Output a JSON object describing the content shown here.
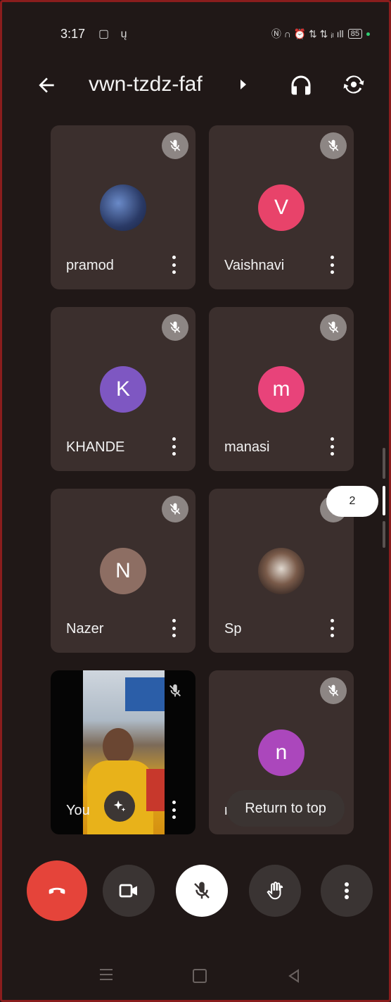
{
  "status_bar": {
    "time": "3:17",
    "left_icons": "▢ ų",
    "right_icons": "Ⓝ ∩ ⏰ ⇅ ⇅ ᵢₗ ıll",
    "battery": "85"
  },
  "header": {
    "meeting_code": "vwn-tzdz-faf"
  },
  "participants": [
    {
      "name": "pramod",
      "initial": "",
      "avatar_color": ""
    },
    {
      "name": "Vaishnavi",
      "initial": "V",
      "avatar_color": "#e8436a"
    },
    {
      "name": "KHANDE",
      "initial": "K",
      "avatar_color": "#7e57c2"
    },
    {
      "name": "manasi",
      "initial": "m",
      "avatar_color": "#e8437a"
    },
    {
      "name": "Nazer",
      "initial": "N",
      "avatar_color": "#8d6e63"
    },
    {
      "name": "Sp",
      "initial": "",
      "avatar_color": ""
    },
    {
      "name": "You",
      "initial": "",
      "avatar_color": ""
    },
    {
      "name": "n",
      "initial": "n",
      "avatar_color": "#ab47bc"
    }
  ],
  "page_indicator": "2",
  "return_to_top": "Return to top",
  "icons": {
    "back": "arrow-left-icon",
    "audio": "headphones-icon",
    "switch_camera": "switch-camera-icon",
    "muted": "mic-off-icon",
    "end_call": "end-call-icon",
    "camera": "video-camera-icon",
    "mic": "mic-off-icon",
    "raise_hand": "hand-icon",
    "more": "more-vert-icon",
    "effects": "sparkle-icon"
  },
  "colors": {
    "background": "#201817",
    "tile": "#3b2f2d",
    "end_call": "#e5443a"
  }
}
